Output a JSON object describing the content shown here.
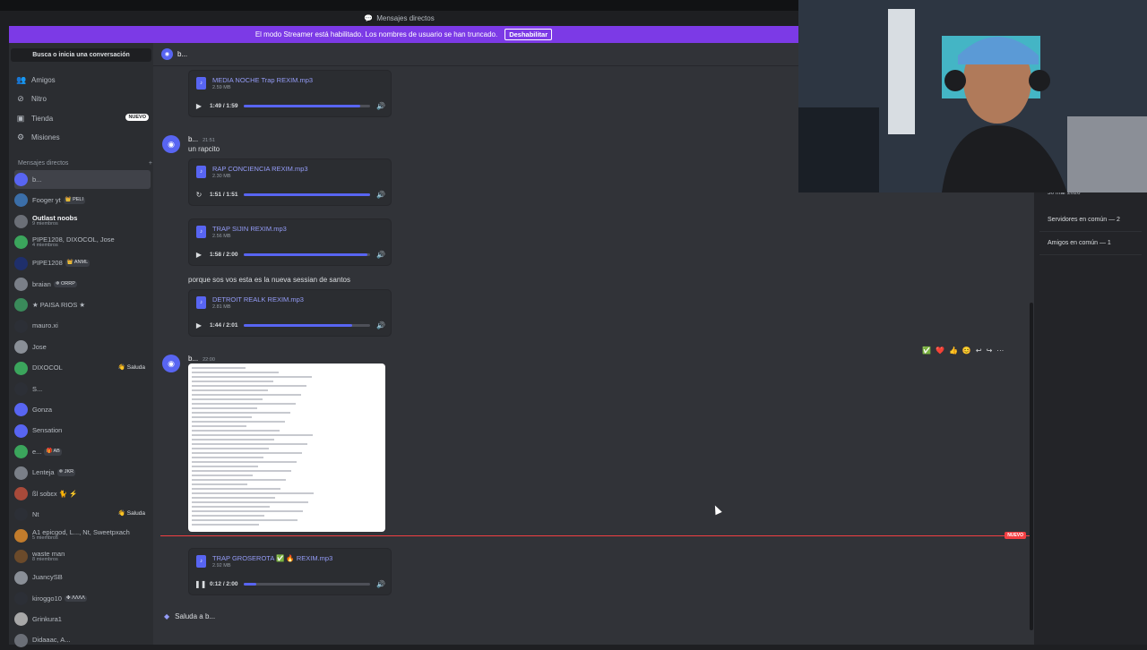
{
  "window": {
    "title": "Mensajes directos"
  },
  "banner": {
    "text": "El modo Streamer está habilitado. Los nombres de usuario se han truncado.",
    "button": "Deshabilitar"
  },
  "sidebar": {
    "search": "Busca o inicia una conversación",
    "nav": [
      {
        "label": "Amigos",
        "icon": "friends-icon"
      },
      {
        "label": "Nitro",
        "icon": "nitro-icon"
      },
      {
        "label": "Tienda",
        "icon": "shop-icon",
        "badge": "NUEVO"
      },
      {
        "label": "Misiones",
        "icon": "quests-icon"
      }
    ],
    "dm_header": "Mensajes directos",
    "dms": [
      {
        "name": "b...",
        "active": true,
        "color": "#5865f2"
      },
      {
        "name": "Fooger yt",
        "tag": "👑 PELI",
        "color": "#3b6ea8"
      },
      {
        "name": "Outlast noobs",
        "sub": "9 miembros",
        "bold": true,
        "color": "#6b6f77"
      },
      {
        "name": "PIPE1208, DIXOCOL, Jose",
        "sub": "4 miembros",
        "color": "#3ba55c"
      },
      {
        "name": "PIPE1208",
        "tag": "👑 ANML",
        "color": "#1f2f6b"
      },
      {
        "name": "braian",
        "tag": "❄ ORRP",
        "color": "#7a7f88"
      },
      {
        "name": "★ PAISA RIOS ★",
        "color": "#3a8a5a"
      },
      {
        "name": "mauro.xi",
        "color": "#2c2f36"
      },
      {
        "name": "Jose",
        "color": "#8a8f97"
      },
      {
        "name": "DIXOCOL",
        "saluda": "👋 Saluda",
        "color": "#3ba55c"
      },
      {
        "name": "S...",
        "color": "#2c2f36"
      },
      {
        "name": "Gonza",
        "color": "#5865f2"
      },
      {
        "name": "Sensation",
        "color": "#5865f2"
      },
      {
        "name": "e...",
        "tag": "🎁 AB",
        "color": "#3ba55c"
      },
      {
        "name": "Lenteja",
        "tag": "❄ JKR",
        "color": "#7a7f88"
      },
      {
        "name": "ßl sobɛx 🐈 ⚡",
        "color": "#a84a3a"
      },
      {
        "name": "Nt",
        "saluda": "👋 Saluda",
        "color": "#2c2f36"
      },
      {
        "name": "A1 epicgod, L..., Nt, Sweetpxach",
        "sub": "5 miembros",
        "color": "#c27c2c"
      },
      {
        "name": "waste man",
        "sub": "8 miembros",
        "color": "#6b4a2a"
      },
      {
        "name": "JuancySB",
        "color": "#8a8f97"
      },
      {
        "name": "kiroggo10",
        "tag": "✤ ɅɅɅɅ",
        "color": "#2c2f36"
      },
      {
        "name": "Grinkura1",
        "color": "#a8a8a8"
      },
      {
        "name": "Didaaac, A...",
        "color": "#6b6f77"
      }
    ]
  },
  "chat": {
    "channel_name": "b...",
    "messages": [
      {
        "author": "b...",
        "time": "21:51",
        "text": "un rapcito"
      },
      {
        "text": "porque sos vos esta es la nueva sessian de santos"
      },
      {
        "author": "b...",
        "time": "22:00"
      }
    ],
    "audios": [
      {
        "name": "MEDIA NOCHE Trap REXIM.mp3",
        "size": "2.59 MB",
        "time": "1:49 / 1:59",
        "progress": 0.92,
        "state": "play"
      },
      {
        "name": "RAP CONCIENCIA REXIM.mp3",
        "size": "2.30 MB",
        "time": "1:51 / 1:51",
        "progress": 1.0,
        "state": "replay"
      },
      {
        "name": "TRAP SIJIN REXIM.mp3",
        "size": "2.56 MB",
        "time": "1:58 / 2:00",
        "progress": 0.98,
        "state": "play"
      },
      {
        "name": "DETROIT REALK REXIM.mp3",
        "size": "2.81 MB",
        "time": "1:44 / 2:01",
        "progress": 0.86,
        "state": "play"
      },
      {
        "name": "TRAP GROSEROTA ✅ 🔥 REXIM.mp3",
        "size": "2.92 MB",
        "time": "0:12 / 2:00",
        "progress": 0.1,
        "state": "pause"
      }
    ],
    "new_badge": "NUEVO",
    "reactions": [
      "✅",
      "❤️",
      "👍",
      "😊",
      "↩",
      "↪",
      "···"
    ],
    "composer_text": "Saluda a b..."
  },
  "right_panel": {
    "date": "30 mar 2026",
    "mutual_servers": "Servidores en común — 2",
    "mutual_friends": "Amigos en común — 1"
  },
  "colors": {
    "accent": "#5865f2",
    "banner": "#7c3ae6",
    "new": "#f23f43"
  }
}
